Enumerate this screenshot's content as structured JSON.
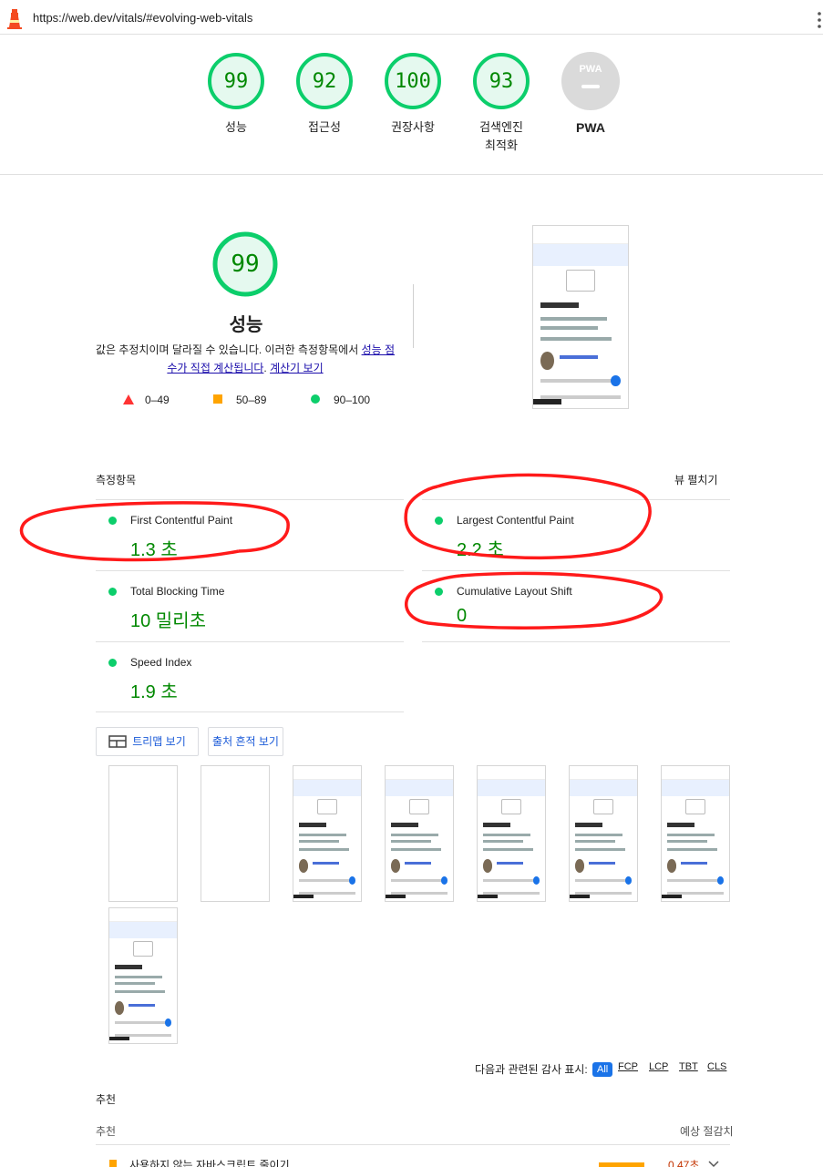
{
  "browser": {
    "url": "https://web.dev/vitals/#evolving-web-vitals"
  },
  "categories": [
    {
      "score": "99",
      "label": "성능",
      "color": "#0cce6b"
    },
    {
      "score": "92",
      "label": "접근성",
      "color": "#0cce6b"
    },
    {
      "score": "100",
      "label": "권장사항",
      "color": "#0cce6b"
    },
    {
      "score": "93",
      "label": "검색엔진\n최적화",
      "label_line1": "검색엔진",
      "label_line2": "최적화",
      "color": "#0cce6b"
    },
    {
      "score": "PWA",
      "label": "PWA",
      "color": "#cccccc"
    }
  ],
  "performance": {
    "score": "99",
    "title": "성능",
    "desc_text": "값은 추정치이며 달라질 수 있습니다. 이러한 측정항목에서 ",
    "desc_link1": "성능 점수가 직접 계산됩니다",
    "desc_mid": ". ",
    "desc_link2": "계산기 보기",
    "legend": [
      {
        "range": "0–49",
        "shape": "triangle",
        "color": "#ff3333"
      },
      {
        "range": "50–89",
        "shape": "square",
        "color": "#ffa400"
      },
      {
        "range": "90–100",
        "shape": "circle",
        "color": "#0cce6b"
      }
    ]
  },
  "metrics_section": {
    "title": "측정항목",
    "expand_label": "뷰 펼치기",
    "items": [
      {
        "name": "First Contentful Paint",
        "value": "1.3 초"
      },
      {
        "name": "Largest Contentful Paint",
        "value": "2.2 초"
      },
      {
        "name": "Total Blocking Time",
        "value": "10 밀리초"
      },
      {
        "name": "Cumulative Layout Shift",
        "value": "0"
      },
      {
        "name": "Speed Index",
        "value": "1.9 초"
      }
    ]
  },
  "buttons": {
    "treemap": "트리맵 보기",
    "trace": "출처 흔적 보기"
  },
  "filter": {
    "label": "다음과 관련된 감사 표시:",
    "chips": [
      "All",
      "FCP",
      "LCP",
      "TBT",
      "CLS"
    ],
    "active": "All"
  },
  "opportunities": {
    "heading": "추천",
    "col_left": "추천",
    "col_right": "예상 절감치",
    "first_item": "사용하지 않는 자바스크립트 줄이기",
    "first_value": "0.47초"
  },
  "annotation_color": "#ff1a1a"
}
